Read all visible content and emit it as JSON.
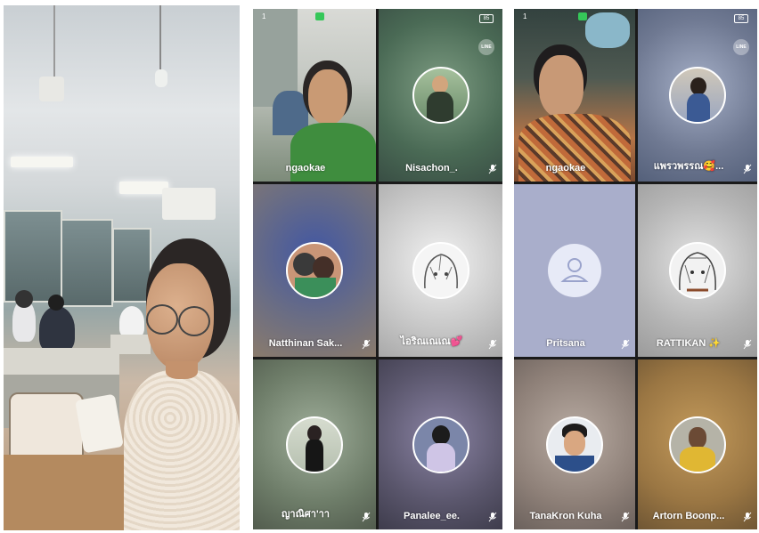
{
  "phone_a": {
    "status": {
      "time": "1",
      "battery": "85"
    },
    "line_badge": "LINE",
    "participants": [
      {
        "name": "ngaokae",
        "bg": "#9aa598",
        "avatar": "self-video"
      },
      {
        "name": "Nisachon_.",
        "bg": "#5c7a63",
        "avatar": "uniform-person"
      },
      {
        "name": "Natthinan Sak...",
        "bg": "#5b6ea8",
        "avatar": "two-kids"
      },
      {
        "name": "ไอริณเณเณ💕",
        "bg": "#cfcfcf",
        "avatar": "anime-sketch"
      },
      {
        "name": "ญาณิศา'าา",
        "bg": "#8a9a86",
        "avatar": "girl-black-dress"
      },
      {
        "name": "Panalee_ee.",
        "bg": "#6a6a86",
        "avatar": "girl-mask"
      }
    ]
  },
  "phone_b": {
    "status": {
      "time": "1",
      "battery": "85"
    },
    "line_badge": "LINE",
    "participants": [
      {
        "name": "ngaokae",
        "bg": "#9a6a4a",
        "avatar": "self-video"
      },
      {
        "name": "แพรวพรรณ🥰...",
        "bg": "#7f8aa7",
        "avatar": "girl-library"
      },
      {
        "name": "Pritsana",
        "bg": "#a6abc9",
        "avatar": "default-person-icon"
      },
      {
        "name": "RATTIKAN ✨",
        "bg": "#b8b8b8",
        "avatar": "anime-sketch"
      },
      {
        "name": "TanaKron Kuha",
        "bg": "#a79a92",
        "avatar": "boy-portrait"
      },
      {
        "name": "Artorn Boonp...",
        "bg": "#a07a46",
        "avatar": "man-yellow-shirt"
      }
    ]
  }
}
